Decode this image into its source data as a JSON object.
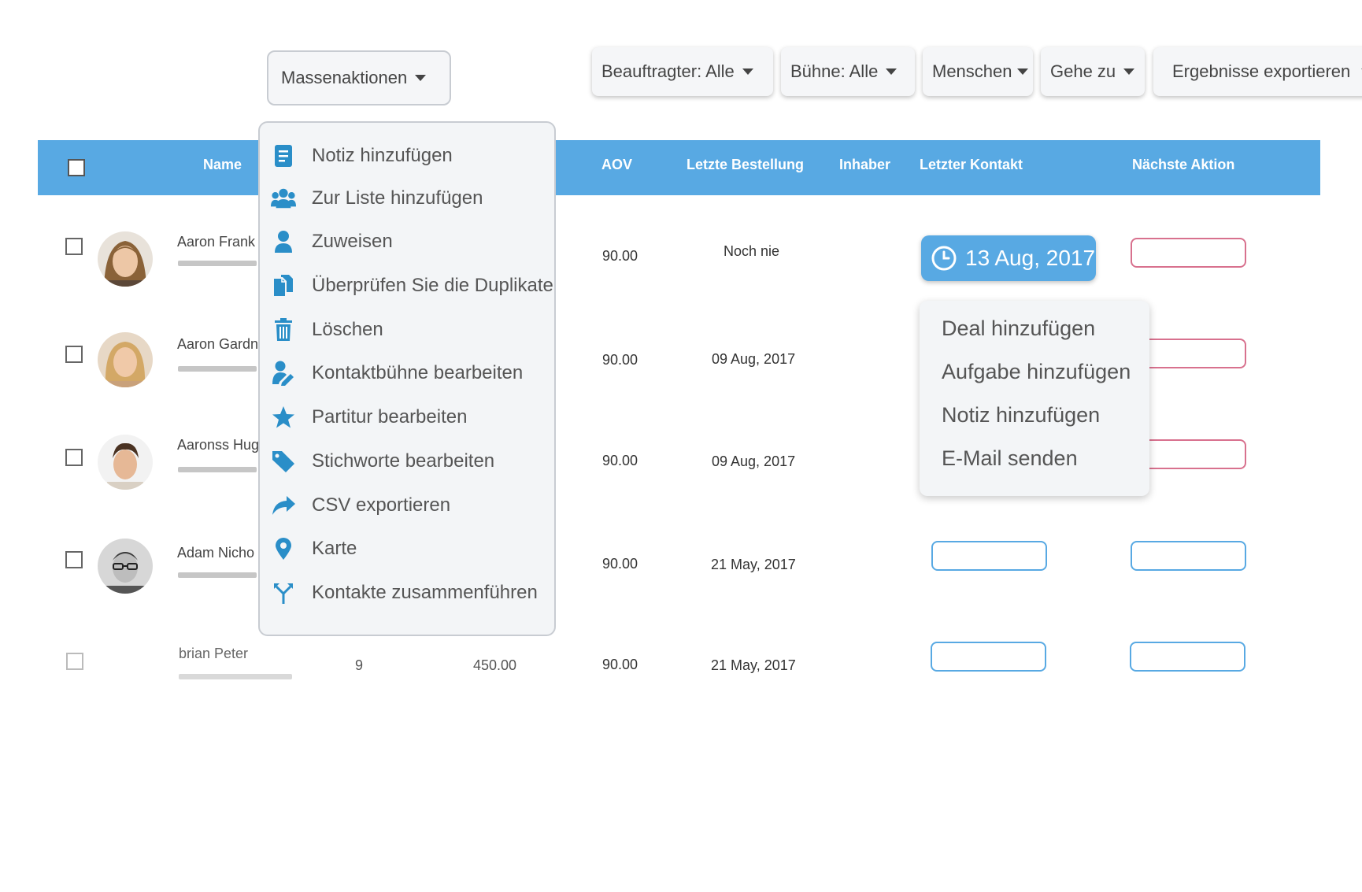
{
  "toolbar": {
    "bulk_actions": "Massenaktionen",
    "assignee_filter": "Beauftragter: Alle",
    "stage_filter": "Bühne: Alle",
    "people_filter": "Menschen",
    "goto": "Gehe zu",
    "export_results": "Ergebnisse exportieren"
  },
  "table": {
    "headers": {
      "name": "Name",
      "aov": "AOV",
      "last_order": "Letzte Bestellung",
      "owner": "Inhaber",
      "last_contact": "Letzter Kontakt",
      "next_action": "Nächste Aktion"
    },
    "rows": [
      {
        "name": "Aaron Frank",
        "aov": "90.00",
        "last_order": "Noch nie"
      },
      {
        "name": "Aaron Gardn",
        "aov": "90.00",
        "last_order": "09 Aug, 2017"
      },
      {
        "name": "Aaronss Hug",
        "aov": "90.00",
        "last_order": "09 Aug, 2017"
      },
      {
        "name": "Adam Nicho",
        "aov": "90.00",
        "last_order": "21 May, 2017"
      },
      {
        "name": "brian Peter",
        "orders": "9",
        "revenue": "450.00",
        "aov": "90.00",
        "last_order": "21 May, 2017"
      }
    ]
  },
  "last_contact_badge": "13 Aug, 2017",
  "bulk_menu": {
    "items": [
      {
        "label": "Notiz hinzufügen",
        "icon": "note-icon"
      },
      {
        "label": "Zur Liste hinzufügen",
        "icon": "users-icon"
      },
      {
        "label": "Zuweisen",
        "icon": "user-icon"
      },
      {
        "label": "Überprüfen Sie die Duplikate",
        "icon": "duplicate-icon"
      },
      {
        "label": "Löschen",
        "icon": "trash-icon"
      },
      {
        "label": "Kontaktbühne bearbeiten",
        "icon": "user-edit-icon"
      },
      {
        "label": "Partitur bearbeiten",
        "icon": "star-icon"
      },
      {
        "label": "Stichworte bearbeiten",
        "icon": "tag-icon"
      },
      {
        "label": "CSV exportieren",
        "icon": "share-icon"
      },
      {
        "label": "Karte",
        "icon": "map-marker-icon"
      },
      {
        "label": "Kontakte zusammenführen",
        "icon": "merge-icon"
      }
    ]
  },
  "action_popup": {
    "items": [
      "Deal hinzufügen",
      "Aufgabe hinzufügen",
      "Notiz hinzufügen",
      "E-Mail senden"
    ]
  },
  "colors": {
    "header_bg": "#58a9e3",
    "icon_blue": "#2a8ec8",
    "pill_red": "#d8718e",
    "pill_blue": "#58a9e3"
  }
}
